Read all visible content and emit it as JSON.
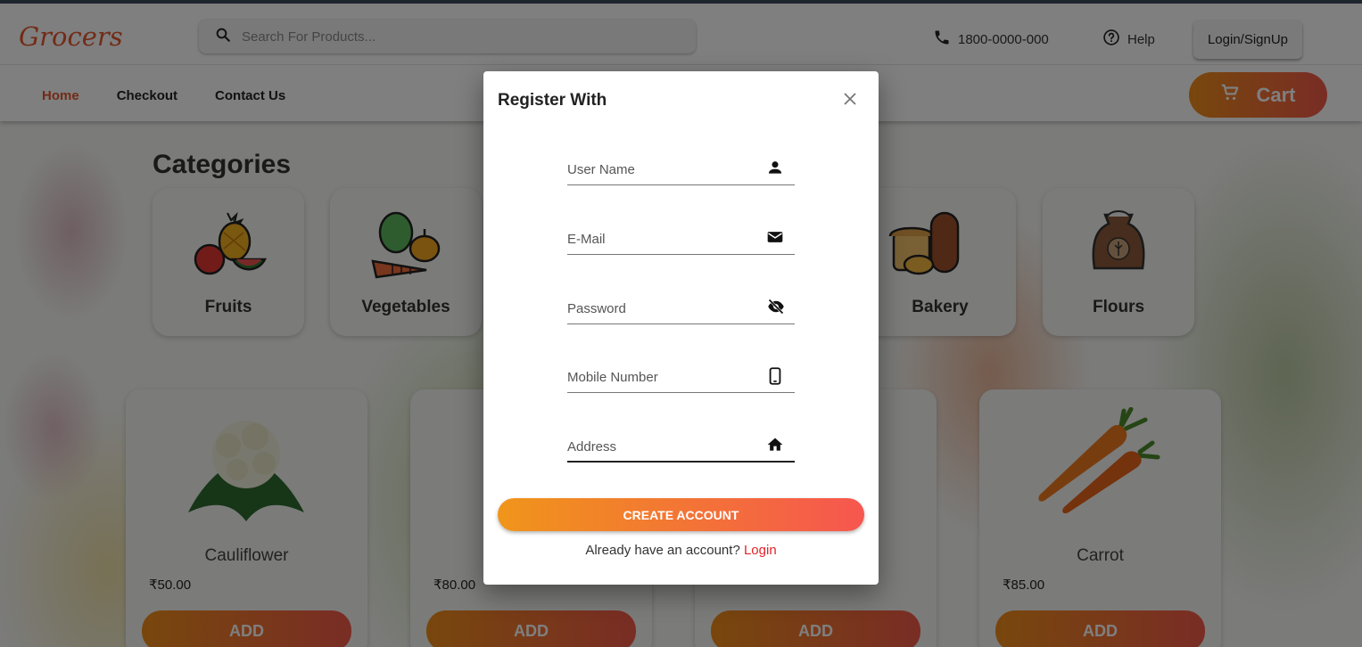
{
  "header": {
    "logo": "Grocers",
    "search_placeholder": "Search For Products...",
    "phone": "1800-0000-000",
    "help": "Help",
    "login": "Login/SignUp",
    "cart": "Cart"
  },
  "nav": [
    "Home",
    "Checkout",
    "Contact Us"
  ],
  "categories": {
    "title": "Categories",
    "items": [
      "Fruits",
      "Vegetables",
      "Bakery",
      "Flours"
    ]
  },
  "products": [
    {
      "name": "Cauliflower",
      "price": "₹50.00",
      "action": "ADD"
    },
    {
      "name": "",
      "price": "₹80.00",
      "action": "ADD"
    },
    {
      "name": "",
      "price": "",
      "action": "ADD"
    },
    {
      "name": "Carrot",
      "price": "₹85.00",
      "action": "ADD"
    }
  ],
  "modal": {
    "title": "Register With",
    "close_icon": "close-icon",
    "fields": [
      {
        "label": "User Name",
        "icon": "person-icon"
      },
      {
        "label": "E-Mail",
        "icon": "mail-icon"
      },
      {
        "label": "Password",
        "icon": "visibility-off-icon"
      },
      {
        "label": "Mobile Number",
        "icon": "smartphone-icon"
      },
      {
        "label": "Address",
        "icon": "home-icon"
      }
    ],
    "submit": "CREATE ACCOUNT",
    "footer_text": "Already have an account?",
    "footer_link": "Login"
  },
  "colors": {
    "accent": "#e4572e",
    "gradient_start": "#f08e1a",
    "gradient_end": "#f35a4a",
    "link": "#e4232a"
  }
}
